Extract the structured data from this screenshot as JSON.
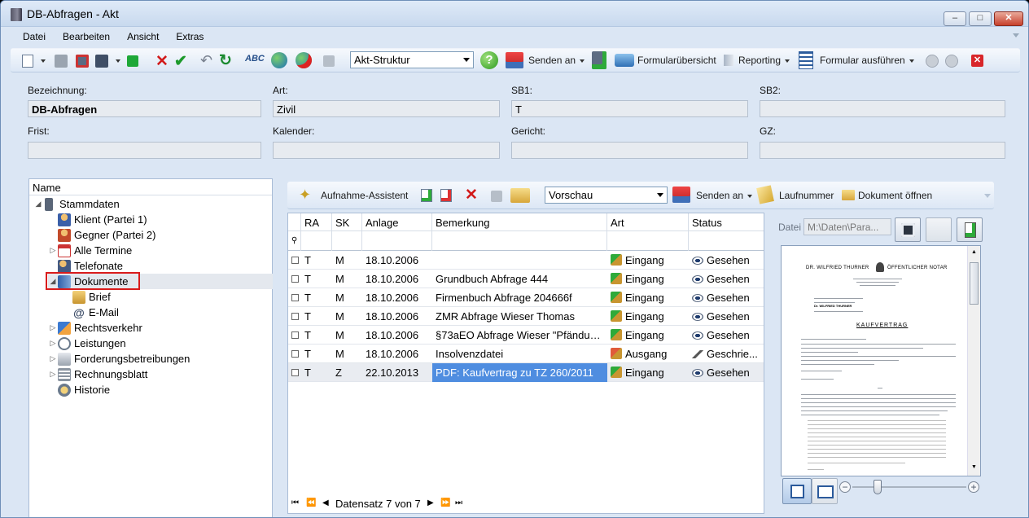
{
  "window": {
    "title": "DB-Abfragen - Akt"
  },
  "menu": [
    "Datei",
    "Bearbeiten",
    "Ansicht",
    "Extras"
  ],
  "toolbar": {
    "structure_select": "Akt-Struktur",
    "send_to": "Senden an",
    "form_overview": "Formularübersicht",
    "reporting": "Reporting",
    "run_form": "Formular ausführen"
  },
  "fields": {
    "bezeichnung": {
      "label": "Bezeichnung:",
      "value": "DB-Abfragen"
    },
    "art": {
      "label": "Art:",
      "value": "Zivil"
    },
    "sb1": {
      "label": "SB1:",
      "value": "T"
    },
    "sb2": {
      "label": "SB2:",
      "value": ""
    },
    "frist": {
      "label": "Frist:",
      "value": ""
    },
    "kalender": {
      "label": "Kalender:",
      "value": ""
    },
    "gericht": {
      "label": "Gericht:",
      "value": ""
    },
    "gz": {
      "label": "GZ:",
      "value": ""
    }
  },
  "tree": {
    "header": "Name",
    "nodes": [
      {
        "label": "Stammdaten"
      },
      {
        "label": "Klient (Partei 1)"
      },
      {
        "label": "Gegner (Partei 2)"
      },
      {
        "label": "Alle Termine"
      },
      {
        "label": "Telefonate"
      },
      {
        "label": "Dokumente"
      },
      {
        "label": "Brief"
      },
      {
        "label": "E-Mail"
      },
      {
        "label": "Rechtsverkehr"
      },
      {
        "label": "Leistungen"
      },
      {
        "label": "Forderungsbetreibungen"
      },
      {
        "label": "Rechnungsblatt"
      },
      {
        "label": "Historie"
      }
    ]
  },
  "doc_toolbar": {
    "assistant": "Aufnahme-Assistent",
    "preview_select": "Vorschau",
    "send_to": "Senden an",
    "serial": "Laufnummer",
    "open_doc": "Dokument öffnen"
  },
  "grid": {
    "columns": [
      "RA",
      "SK",
      "Anlage",
      "Bemerkung",
      "Art",
      "Status"
    ],
    "filter_icon": "filter-pin-icon",
    "rows": [
      {
        "ra": "T",
        "sk": "M",
        "anlage": "18.10.2006",
        "bemerkung": "",
        "art": "Eingang",
        "status": "Gesehen"
      },
      {
        "ra": "T",
        "sk": "M",
        "anlage": "18.10.2006",
        "bemerkung": "Grundbuch Abfrage 444",
        "art": "Eingang",
        "status": "Gesehen"
      },
      {
        "ra": "T",
        "sk": "M",
        "anlage": "18.10.2006",
        "bemerkung": "Firmenbuch Abfrage 204666f",
        "art": "Eingang",
        "status": "Gesehen"
      },
      {
        "ra": "T",
        "sk": "M",
        "anlage": "18.10.2006",
        "bemerkung": "ZMR Abfrage Wieser Thomas",
        "art": "Eingang",
        "status": "Gesehen"
      },
      {
        "ra": "T",
        "sk": "M",
        "anlage": "18.10.2006",
        "bemerkung": "§73aEO Abfrage Wieser \"Pfändun...",
        "art": "Eingang",
        "status": "Gesehen"
      },
      {
        "ra": "T",
        "sk": "M",
        "anlage": "18.10.2006",
        "bemerkung": "Insolvenzdatei",
        "art": "Ausgang",
        "status": "Geschrie..."
      },
      {
        "ra": "T",
        "sk": "Z",
        "anlage": "22.10.2013",
        "bemerkung": "PDF: Kaufvertrag zu TZ 260/2011",
        "art": "Eingang",
        "status": "Gesehen"
      }
    ],
    "record_nav": "Datensatz 7 von 7"
  },
  "preview": {
    "file_label": "Datei",
    "file_path": "M:\\Daten\\Para...",
    "doc_header_left": "DR. WILFRIED THURNER",
    "doc_header_right": "ÖFFENTLICHER NOTAR",
    "doc_title": "KAUFVERTRAG",
    "doc_signer": "Dr. WILFRIED THURNER"
  },
  "colors": {
    "accent": "#4f8de0",
    "highlight_border": "#d91c1c"
  }
}
